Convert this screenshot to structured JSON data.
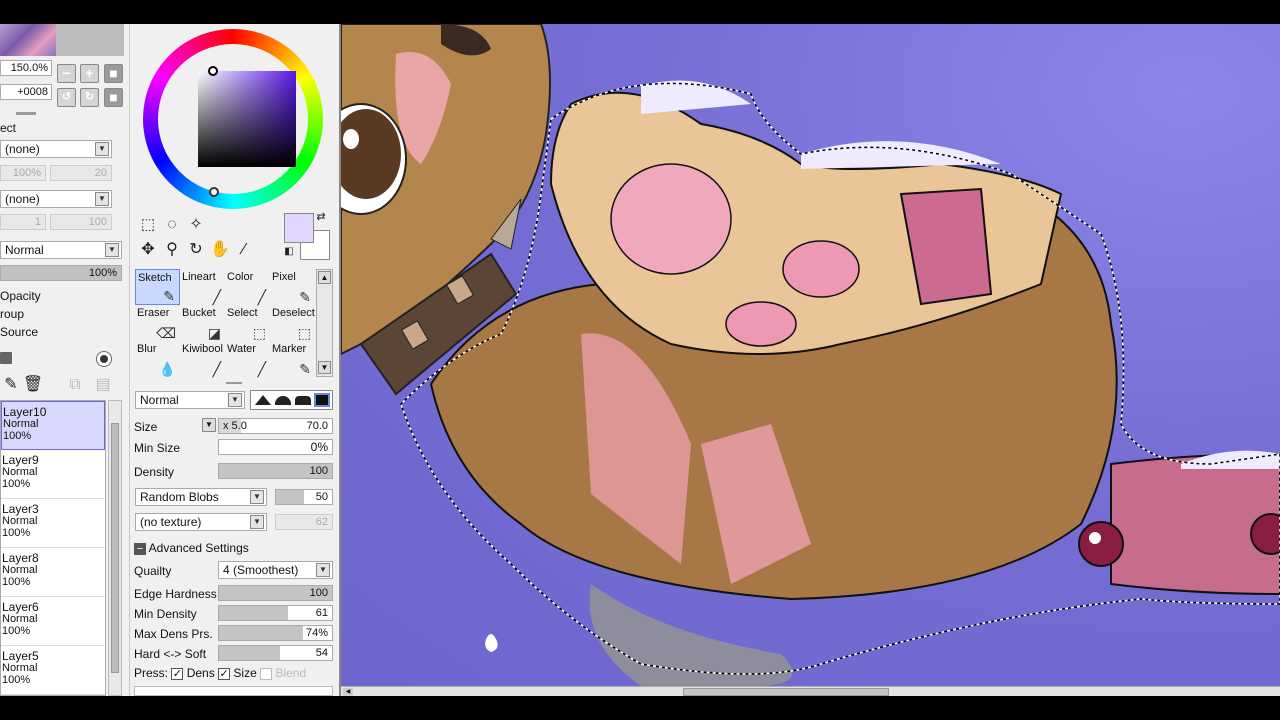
{
  "navigator": {
    "zoom": "150.0%",
    "rotation": "+0008"
  },
  "layer_props": {
    "select_label": "ect",
    "texture_dd_1": "(none)",
    "texture_val_1": "100%",
    "texture_num_1": "20",
    "texture_dd_2": "(none)",
    "texture_val_2": "1",
    "texture_num_2": "100",
    "blend_mode": "Normal",
    "opacity": "100%",
    "opacity_label": "Opacity",
    "group_label": "roup",
    "source_label": "Source"
  },
  "layers": [
    {
      "name": "Layer10",
      "mode": "Normal",
      "opacity": "100%",
      "selected": true
    },
    {
      "name": "Layer9",
      "mode": "Normal",
      "opacity": "100%"
    },
    {
      "name": "Layer3",
      "mode": "Normal",
      "opacity": "100%"
    },
    {
      "name": "Layer8",
      "mode": "Normal",
      "opacity": "100%"
    },
    {
      "name": "Layer6",
      "mode": "Normal",
      "opacity": "100%"
    },
    {
      "name": "Layer5",
      "mode": "Normal",
      "opacity": "100%"
    }
  ],
  "colors": {
    "foreground": "#e0d6ff",
    "background": "#ffffff",
    "canvas_bg": "#766ed4"
  },
  "brushes": [
    {
      "label": "Sketch",
      "icon": "pencil-icon",
      "selected": true
    },
    {
      "label": "Lineart",
      "icon": "pen-icon"
    },
    {
      "label": "Color",
      "icon": "pen-icon"
    },
    {
      "label": "Pixel",
      "icon": "pencil-icon"
    },
    {
      "label": "Eraser",
      "icon": "eraser-icon"
    },
    {
      "label": "Bucket",
      "icon": "bucket-icon"
    },
    {
      "label": "Select",
      "icon": "select-icon"
    },
    {
      "label": "Deselect",
      "icon": "deselect-icon"
    },
    {
      "label": "Blur",
      "icon": "blur-icon"
    },
    {
      "label": "Kiwibool",
      "icon": "pen-icon"
    },
    {
      "label": "Water",
      "icon": "water-icon"
    },
    {
      "label": "Marker",
      "icon": "marker-icon"
    }
  ],
  "brush_settings": {
    "blend_mode": "Normal",
    "size_label": "Size",
    "size_mult": "x 5.0",
    "size_value": "70.0",
    "min_size_label": "Min Size",
    "min_size_value": "0%",
    "density_label": "Density",
    "density_value": "100",
    "density_fill": 1.0,
    "shape_dd": "Random Blobs",
    "shape_value": "50",
    "shape_fill": 0.5,
    "texture_dd": "(no texture)",
    "texture_value": "62",
    "advanced_label": "Advanced Settings",
    "quality_label": "Quailty",
    "quality_value": "4 (Smoothest)",
    "edge_label": "Edge Hardness",
    "edge_value": "100",
    "edge_fill": 1.0,
    "min_density_label": "Min Density",
    "min_density_value": "61",
    "min_density_fill": 0.61,
    "max_dens_label": "Max Dens Prs.",
    "max_dens_value": "74%",
    "max_dens_fill": 0.74,
    "hard_soft_label": "Hard <-> Soft",
    "hard_soft_value": "54",
    "hard_soft_fill": 0.54,
    "press_label": "Press:",
    "press_dens": "Dens",
    "press_size": "Size",
    "press_blend": "Blend"
  }
}
